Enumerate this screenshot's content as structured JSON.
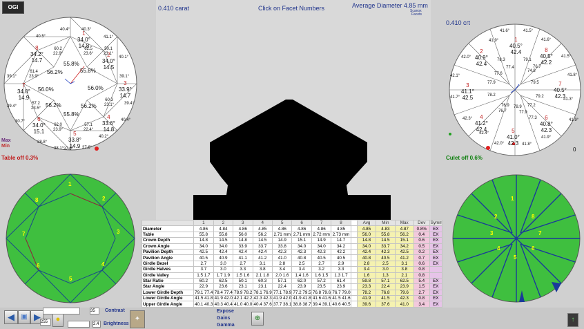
{
  "header": {
    "carat": "0.410 carat",
    "prompt": "Click on Facet Numbers",
    "avg_diameter": "Average Diameter 4.85 mm",
    "scanox": "Scanox",
    "facets": "Facets",
    "right_carat": "0.410 crt",
    "right_zero": "0"
  },
  "logo": {
    "text": "OGI"
  },
  "left": {
    "table_off": "Table off 0.3%",
    "max_label": "Max",
    "min_label": "Min",
    "crown_outer": [
      "40.5°",
      "40.3°",
      "41.1°",
      "40.1°",
      "39.1°",
      "39.4°",
      "39.4°",
      "39.1°",
      "37.9°",
      "37.6°",
      "38.1°",
      "38.8°",
      "30.7°",
      "40.4°",
      "40.2°",
      "40.4°"
    ],
    "crown_mains": [
      {
        "n": "1",
        "a": "34.0°",
        "h": "14.8"
      },
      {
        "n": "2",
        "a": "34.0°",
        "h": "14.5"
      },
      {
        "n": "3",
        "a": "33.9°",
        "h": "14.7"
      },
      {
        "n": "4",
        "a": "33.6°",
        "h": "14.8"
      },
      {
        "n": "5",
        "a": "33.8°",
        "h": "14.9"
      },
      {
        "n": "6",
        "a": "34.0°",
        "h": "15.1"
      },
      {
        "n": "7",
        "a": "34.0°",
        "h": "14.9"
      },
      {
        "n": "8",
        "a": "34.2°",
        "h": "14.7"
      }
    ],
    "stars": [
      {
        "r": "60.2",
        "a": "22.9°"
      },
      {
        "r": "62.5",
        "a": "23.6°"
      },
      {
        "r": "60.3",
        "a": "23.1°"
      },
      {
        "r": "57.1",
        "a": "22.4°"
      },
      {
        "r": "62.0",
        "a": "23.9°"
      },
      {
        "r": "57.2",
        "a": "23.5°"
      },
      {
        "r": "61.4",
        "a": "23.9°"
      },
      {
        "r": "50.1",
        "a": "23.1°"
      }
    ],
    "table_pcts": [
      "55.8%",
      "55.8%",
      "56.2%",
      "56.0%",
      "56.2%",
      "55.8%",
      "56.2%",
      "56.0%",
      "55.8%"
    ]
  },
  "right": {
    "culet_off": "Culet off 0.6%",
    "pav_outer": [
      "41.6°",
      "41.5°",
      "41.9°",
      "41.6°",
      "42.0°",
      "41.5°",
      "41.8°",
      "41.7°",
      "42.1°",
      "41.3°",
      "42.3°",
      "41.9°",
      "41.9°",
      "42.4°",
      "42.0°",
      "41.8°"
    ],
    "pav_mains": [
      {
        "n": "1",
        "a": "40.5°",
        "h": "42.4"
      },
      {
        "n": "2",
        "a": "40.9°",
        "h": "42.4"
      },
      {
        "n": "3",
        "a": "41.1°",
        "h": "42.5"
      },
      {
        "n": "4",
        "a": "41.2°",
        "h": "42.4"
      },
      {
        "n": "5",
        "a": "41.0°",
        "h": "42.3"
      },
      {
        "n": "6",
        "a": "40.8°",
        "h": "42.3"
      },
      {
        "n": "7",
        "a": "40.5°",
        "h": "42.3"
      },
      {
        "n": "8",
        "a": "40.5°",
        "h": "42.2"
      }
    ],
    "lgf": [
      "78.3",
      "77.4",
      "79.1",
      "79.5",
      "79.2",
      "78.2",
      "77.3",
      "76.7",
      "76.9",
      "78.9",
      "77.2",
      "77.6",
      "74.8",
      "77.9",
      "76.7",
      "77.9"
    ]
  },
  "facet_numbers": [
    "1",
    "2",
    "3",
    "4",
    "5",
    "6",
    "7",
    "8"
  ],
  "table": {
    "headers": [
      "",
      "1",
      "2",
      "3",
      "4",
      "5",
      "6",
      "7",
      "8",
      "Avg",
      "Min",
      "Max",
      "Dev",
      "Symm"
    ],
    "rows": [
      [
        "Diameter",
        "4.86",
        "4.84",
        "4.86",
        "4.85",
        "4.86",
        "4.86",
        "4.86",
        "4.85",
        "4.85",
        "4.83",
        "4.87",
        "0.8%",
        "EX"
      ],
      [
        "Table",
        "55.8",
        "55.8",
        "56.0",
        "56.2",
        "2.71 mm",
        "2.71 mm",
        "2.72 mm",
        "2.73 mm",
        "56.0",
        "55.8",
        "56.2",
        "0.4",
        "EX"
      ],
      [
        "Crown Depth",
        "14.8",
        "14.5",
        "14.8",
        "14.5",
        "14.9",
        "15.1",
        "14.9",
        "14.7",
        "14.8",
        "14.5",
        "15.1",
        "0.6",
        "EX"
      ],
      [
        "Crown Angle",
        "34.0",
        "34.0",
        "33.9",
        "33.7",
        "33.8",
        "34.0",
        "34.0",
        "34.2",
        "34.0",
        "33.7",
        "34.2",
        "0.5",
        "EX"
      ],
      [
        "Pavilion Depth",
        "42.5",
        "42.4",
        "42.4",
        "42.4",
        "42.3",
        "42.3",
        "42.3",
        "42.2",
        "42.4",
        "42.3",
        "42.5",
        "0.2",
        "EX"
      ],
      [
        "Pavilion Angle",
        "40.5",
        "40.9",
        "41.1",
        "41.2",
        "41.0",
        "40.8",
        "40.5",
        "40.5",
        "40.8",
        "40.5",
        "41.2",
        "0.7",
        "EX"
      ],
      [
        "Girdle Bezel",
        "2.7",
        "3.0",
        "2.7",
        "3.1",
        "2.8",
        "2.5",
        "2.7",
        "2.9",
        "2.8",
        "2.5",
        "3.1",
        "0.6",
        "EX"
      ],
      [
        "Girdle Halves",
        "3.7",
        "3.0",
        "3.3",
        "3.8",
        "3.4",
        "3.4",
        "3.2",
        "3.3",
        "3.4",
        "3.0",
        "3.8",
        "0.8",
        ""
      ],
      [
        "Girdle Valley",
        "1.5 1.7",
        "1.7 1.9",
        "1.5 1.6",
        "2.1 1.8",
        "2.0 1.6",
        "1.4 1.6",
        "1.6 1.5",
        "1.3 1.7",
        "1.6",
        "1.3",
        "2.1",
        "0.8",
        ""
      ],
      [
        "Star Ratio",
        "60.2",
        "62.5",
        "50.1",
        "60.3",
        "57.1",
        "62.0",
        "57.2",
        "61.4",
        "59.8",
        "57.1",
        "62.5",
        "5.4",
        "EX"
      ],
      [
        "Star Angle",
        "22.9",
        "23.6",
        "23.1",
        "23.1",
        "22.4",
        "23.9",
        "23.5",
        "23.9",
        "23.3",
        "22.4",
        "23.9",
        "1.5",
        "EX"
      ],
      [
        "Lower Girdle Depth",
        "79.1 77.4",
        "78.4 77.4",
        "78.9 78.2",
        "78.1 76.9",
        "77.1 78.9",
        "77.2 79.5",
        "76.8 79.6",
        "76.7 79.0",
        "78.2",
        "76.8",
        "79.6",
        "2.7",
        "EX"
      ],
      [
        "Lower Girdle Angle",
        "41.5 41.8",
        "41.9 42.0",
        "42.1 42.2",
        "42.3 42.3",
        "41.9 42.0",
        "41.9 41.8",
        "41.6 41.6",
        "41.5 41.6",
        "41.9",
        "41.5",
        "42.3",
        "0.8",
        "EX"
      ],
      [
        "Upper Girdle Angle",
        "40.1 40.3",
        "40.3 40.4",
        "41.0 40.0",
        "40.4 37.6",
        "37.7 38.1",
        "38.8 38.7",
        "39.4 39.1",
        "40.6 40.5",
        "39.6",
        "37.6",
        "41.0",
        "3.4",
        "EX"
      ]
    ]
  },
  "bottom": {
    "contrast_label": "Contrast",
    "brightness_label": "Brightness",
    "contrast_val": "35",
    "brightness_val": "2.4",
    "val255": "255",
    "expose": "Expose",
    "gains": "Gains",
    "gamma": "Gamma"
  }
}
